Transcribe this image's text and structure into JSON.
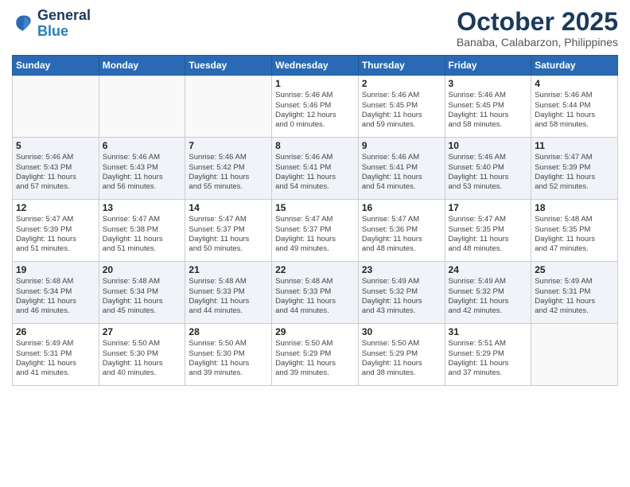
{
  "header": {
    "logo_line1": "General",
    "logo_line2": "Blue",
    "month": "October 2025",
    "location": "Banaba, Calabarzon, Philippines"
  },
  "weekdays": [
    "Sunday",
    "Monday",
    "Tuesday",
    "Wednesday",
    "Thursday",
    "Friday",
    "Saturday"
  ],
  "weeks": [
    [
      {
        "day": "",
        "info": ""
      },
      {
        "day": "",
        "info": ""
      },
      {
        "day": "",
        "info": ""
      },
      {
        "day": "1",
        "info": "Sunrise: 5:46 AM\nSunset: 5:46 PM\nDaylight: 12 hours\nand 0 minutes."
      },
      {
        "day": "2",
        "info": "Sunrise: 5:46 AM\nSunset: 5:45 PM\nDaylight: 11 hours\nand 59 minutes."
      },
      {
        "day": "3",
        "info": "Sunrise: 5:46 AM\nSunset: 5:45 PM\nDaylight: 11 hours\nand 58 minutes."
      },
      {
        "day": "4",
        "info": "Sunrise: 5:46 AM\nSunset: 5:44 PM\nDaylight: 11 hours\nand 58 minutes."
      }
    ],
    [
      {
        "day": "5",
        "info": "Sunrise: 5:46 AM\nSunset: 5:43 PM\nDaylight: 11 hours\nand 57 minutes."
      },
      {
        "day": "6",
        "info": "Sunrise: 5:46 AM\nSunset: 5:43 PM\nDaylight: 11 hours\nand 56 minutes."
      },
      {
        "day": "7",
        "info": "Sunrise: 5:46 AM\nSunset: 5:42 PM\nDaylight: 11 hours\nand 55 minutes."
      },
      {
        "day": "8",
        "info": "Sunrise: 5:46 AM\nSunset: 5:41 PM\nDaylight: 11 hours\nand 54 minutes."
      },
      {
        "day": "9",
        "info": "Sunrise: 5:46 AM\nSunset: 5:41 PM\nDaylight: 11 hours\nand 54 minutes."
      },
      {
        "day": "10",
        "info": "Sunrise: 5:46 AM\nSunset: 5:40 PM\nDaylight: 11 hours\nand 53 minutes."
      },
      {
        "day": "11",
        "info": "Sunrise: 5:47 AM\nSunset: 5:39 PM\nDaylight: 11 hours\nand 52 minutes."
      }
    ],
    [
      {
        "day": "12",
        "info": "Sunrise: 5:47 AM\nSunset: 5:39 PM\nDaylight: 11 hours\nand 51 minutes."
      },
      {
        "day": "13",
        "info": "Sunrise: 5:47 AM\nSunset: 5:38 PM\nDaylight: 11 hours\nand 51 minutes."
      },
      {
        "day": "14",
        "info": "Sunrise: 5:47 AM\nSunset: 5:37 PM\nDaylight: 11 hours\nand 50 minutes."
      },
      {
        "day": "15",
        "info": "Sunrise: 5:47 AM\nSunset: 5:37 PM\nDaylight: 11 hours\nand 49 minutes."
      },
      {
        "day": "16",
        "info": "Sunrise: 5:47 AM\nSunset: 5:36 PM\nDaylight: 11 hours\nand 48 minutes."
      },
      {
        "day": "17",
        "info": "Sunrise: 5:47 AM\nSunset: 5:35 PM\nDaylight: 11 hours\nand 48 minutes."
      },
      {
        "day": "18",
        "info": "Sunrise: 5:48 AM\nSunset: 5:35 PM\nDaylight: 11 hours\nand 47 minutes."
      }
    ],
    [
      {
        "day": "19",
        "info": "Sunrise: 5:48 AM\nSunset: 5:34 PM\nDaylight: 11 hours\nand 46 minutes."
      },
      {
        "day": "20",
        "info": "Sunrise: 5:48 AM\nSunset: 5:34 PM\nDaylight: 11 hours\nand 45 minutes."
      },
      {
        "day": "21",
        "info": "Sunrise: 5:48 AM\nSunset: 5:33 PM\nDaylight: 11 hours\nand 44 minutes."
      },
      {
        "day": "22",
        "info": "Sunrise: 5:48 AM\nSunset: 5:33 PM\nDaylight: 11 hours\nand 44 minutes."
      },
      {
        "day": "23",
        "info": "Sunrise: 5:49 AM\nSunset: 5:32 PM\nDaylight: 11 hours\nand 43 minutes."
      },
      {
        "day": "24",
        "info": "Sunrise: 5:49 AM\nSunset: 5:32 PM\nDaylight: 11 hours\nand 42 minutes."
      },
      {
        "day": "25",
        "info": "Sunrise: 5:49 AM\nSunset: 5:31 PM\nDaylight: 11 hours\nand 42 minutes."
      }
    ],
    [
      {
        "day": "26",
        "info": "Sunrise: 5:49 AM\nSunset: 5:31 PM\nDaylight: 11 hours\nand 41 minutes."
      },
      {
        "day": "27",
        "info": "Sunrise: 5:50 AM\nSunset: 5:30 PM\nDaylight: 11 hours\nand 40 minutes."
      },
      {
        "day": "28",
        "info": "Sunrise: 5:50 AM\nSunset: 5:30 PM\nDaylight: 11 hours\nand 39 minutes."
      },
      {
        "day": "29",
        "info": "Sunrise: 5:50 AM\nSunset: 5:29 PM\nDaylight: 11 hours\nand 39 minutes."
      },
      {
        "day": "30",
        "info": "Sunrise: 5:50 AM\nSunset: 5:29 PM\nDaylight: 11 hours\nand 38 minutes."
      },
      {
        "day": "31",
        "info": "Sunrise: 5:51 AM\nSunset: 5:29 PM\nDaylight: 11 hours\nand 37 minutes."
      },
      {
        "day": "",
        "info": ""
      }
    ]
  ]
}
